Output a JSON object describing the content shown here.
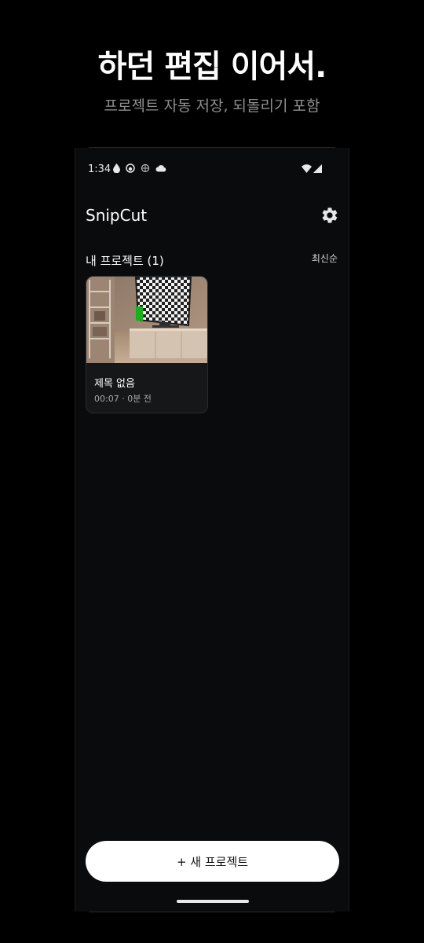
{
  "hero": {
    "title": "하던 편집 이어서.",
    "subtitle": "프로젝트 자동 저장, 되돌리기 포함"
  },
  "status_bar": {
    "time": "1:34",
    "left_icons": [
      "water-drop-icon",
      "face-icon",
      "vpn-icon",
      "cloud-icon"
    ],
    "right_icons": [
      "wifi-icon",
      "signal-icon"
    ]
  },
  "app": {
    "title": "SnipCut",
    "settings_icon": "gear-icon"
  },
  "projects": {
    "section_title": "내 프로젝트 (1)",
    "sort_label": "최신순",
    "items": [
      {
        "name": "제목 없음",
        "meta": "00:07 · 0분 전"
      }
    ]
  },
  "actions": {
    "new_project_label": "+ 새 프로젝트"
  },
  "colors": {
    "page_background": "#000000",
    "screen_background": "#0a0b0d",
    "card_background": "#161718",
    "button_background": "#ffffff",
    "subtitle_text": "#8e8e8e"
  }
}
